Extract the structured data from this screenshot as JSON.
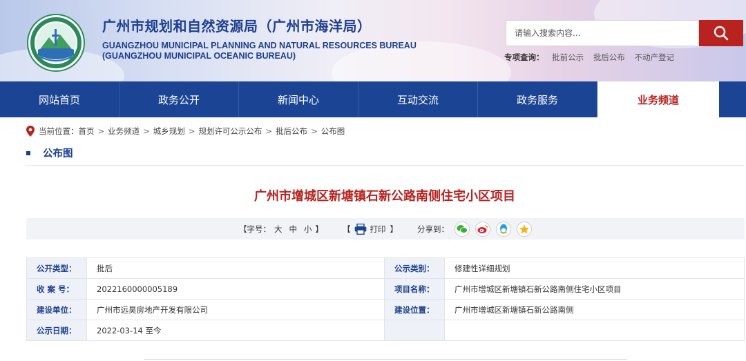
{
  "header": {
    "title_cn": "广州市规划和自然资源局（广州市海洋局）",
    "title_en_line1": "GUANGZHOU MUNICIPAL PLANNING AND NATURAL RESOURCES BUREAU",
    "title_en_line2": "(GUANGZHOU MUNICIPAL OCEANIC BUREAU)",
    "search_placeholder": "请输入搜索内容...",
    "special_label": "专项查询：",
    "special_links": [
      "批前公示",
      "批后公布",
      "不动产登记"
    ]
  },
  "nav": {
    "items": [
      "网站首页",
      "政务公开",
      "新闻中心",
      "互动交流",
      "政务服务",
      "业务频道"
    ],
    "active_index": 5
  },
  "breadcrumb": {
    "label": "当前位置：",
    "items": [
      "首页",
      "业务频道",
      "城乡规划",
      "规划许可公示公布",
      "批后公布",
      "公布图"
    ]
  },
  "section_title": "公布图",
  "article_title": "广州市增城区新塘镇石新公路南侧住宅小区项目",
  "toolbar": {
    "font_label": "【字号：",
    "size_large": "大",
    "size_medium": "中",
    "size_small": "小",
    "font_close": "】",
    "print_open": "【",
    "print_label": "打印",
    "print_close": "】",
    "share_label": "分享到：",
    "share_icons": [
      "wechat-icon",
      "weibo-icon",
      "qq-icon",
      "qzone-icon"
    ]
  },
  "info": {
    "rows": [
      {
        "k1": "公开类型：",
        "v1": "批后",
        "k2": "公示类别：",
        "v2": "修建性详细规划"
      },
      {
        "k1": "收 案 号：",
        "v1": "2022160000005189",
        "k2": "项目名称：",
        "v2": "广州市增城区新塘镇石新公路南侧住宅小区项目"
      },
      {
        "k1": "建设单位：",
        "v1": "广州市远昊房地产开发有限公司",
        "k2": "建设位置：",
        "v2": "广州市增城区新塘镇石新公路南侧"
      },
      {
        "k1": "公示日期：",
        "v1": "2022-03-14 至今",
        "k2": "",
        "v2": ""
      }
    ]
  },
  "colors": {
    "brand_blue": "#1b4494",
    "accent_red": "#b8221f",
    "title_blue": "#1d3f8f"
  }
}
